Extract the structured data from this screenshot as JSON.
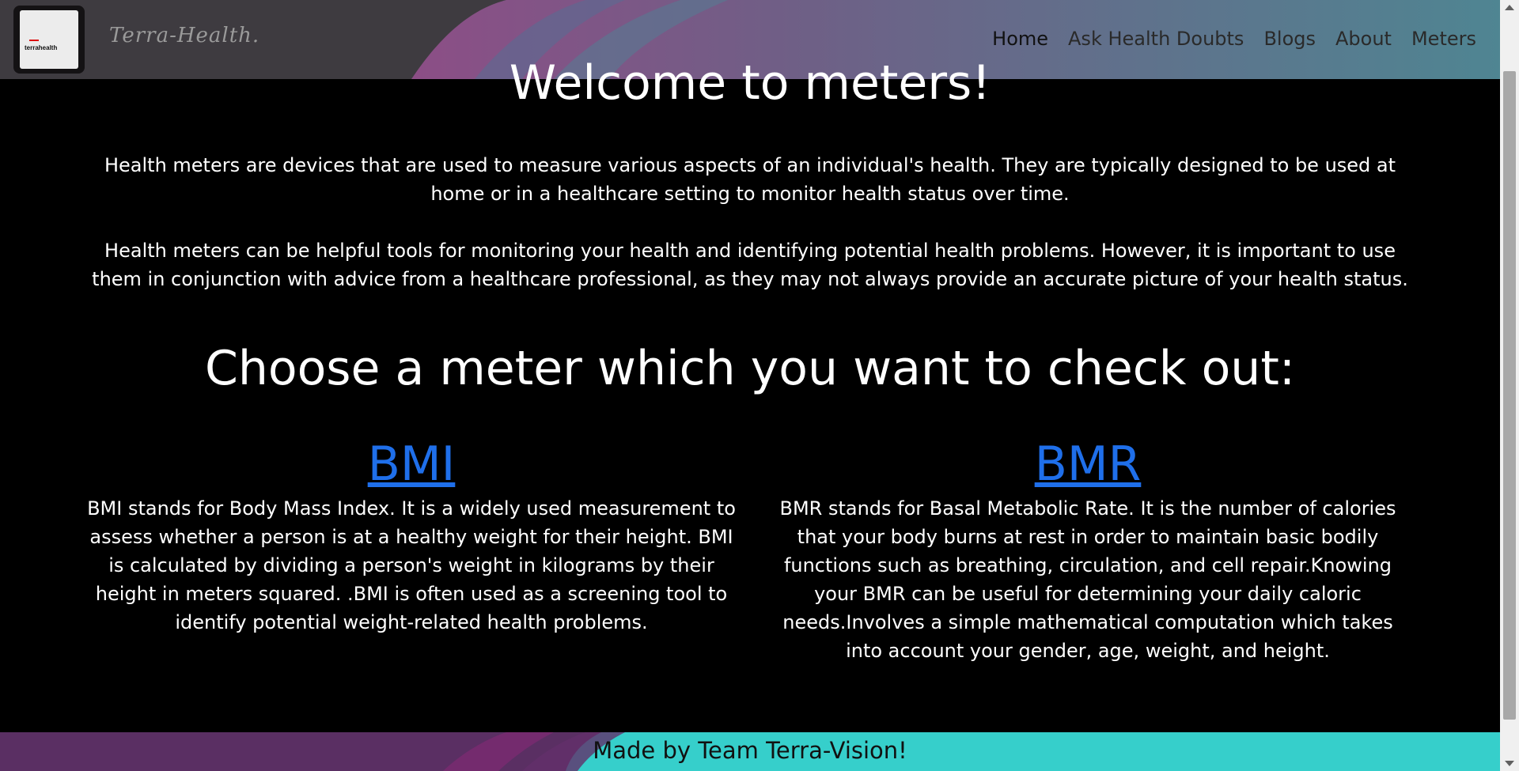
{
  "header": {
    "logo_text": "terrahealth",
    "brand": "Terra-Health.",
    "nav": [
      {
        "label": "Home",
        "active": true
      },
      {
        "label": "Ask Health Doubts",
        "active": false
      },
      {
        "label": "Blogs",
        "active": false
      },
      {
        "label": "About",
        "active": false
      },
      {
        "label": "Meters",
        "active": false
      }
    ]
  },
  "main": {
    "welcome_title": "Welcome to meters!",
    "intro_p1": "Health meters are devices that are used to measure various aspects of an individual's health. They are typically designed to be used at home or in a healthcare setting to monitor health status over time.",
    "intro_p2": "Health meters can be helpful tools for monitoring your health and identifying potential health problems. However, it is important to use them in conjunction with advice from a healthcare professional, as they may not always provide an accurate picture of your health status.",
    "choose_title": "Choose a meter which you want to check out:",
    "meters": [
      {
        "label": "BMI",
        "description": "BMI stands for Body Mass Index. It is a widely used measurement to assess whether a person is at a healthy weight for their height. BMI is calculated by dividing a person's weight in kilograms by their height in meters squared. .BMI is often used as a screening tool to identify potential weight-related health problems."
      },
      {
        "label": "BMR",
        "description": "BMR stands for Basal Metabolic Rate. It is the number of calories that your body burns at rest in order to maintain basic bodily functions such as breathing, circulation, and cell repair.Knowing your BMR can be useful for determining your daily caloric needs.Involves a simple mathematical computation which takes into account your gender, age, weight, and height."
      }
    ]
  },
  "footer": {
    "text": "Made by Team Terra-Vision!"
  },
  "colors": {
    "header_base": "#3e3b40",
    "header_accent_pink": "#8c4e86",
    "header_accent_teal": "#4f8592",
    "link_blue": "#1f6fea",
    "footer_teal": "#36cfcb",
    "footer_purple": "#6a2f6a"
  }
}
